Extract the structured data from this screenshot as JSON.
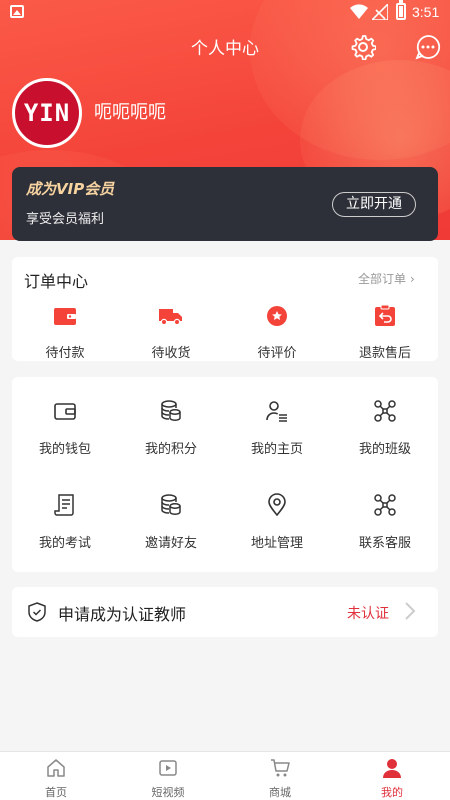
{
  "status_bar": {
    "time": "3:51"
  },
  "header": {
    "title": "个人中心"
  },
  "profile": {
    "avatar_text": "YIN",
    "username": "呃呃呃呃"
  },
  "vip": {
    "title": "成为VIP会员",
    "subtitle": "享受会员福利",
    "button": "立即开通"
  },
  "orders": {
    "title": "订单中心",
    "all_label": "全部订单",
    "items": [
      {
        "label": "待付款",
        "icon": "wallet-icon"
      },
      {
        "label": "待收货",
        "icon": "truck-icon"
      },
      {
        "label": "待评价",
        "icon": "star-badge-icon"
      },
      {
        "label": "退款售后",
        "icon": "refund-icon"
      }
    ]
  },
  "services": [
    {
      "label": "我的钱包",
      "icon": "wallet-outline-icon"
    },
    {
      "label": "我的积分",
      "icon": "coins-icon"
    },
    {
      "label": "我的主页",
      "icon": "user-list-icon"
    },
    {
      "label": "我的班级",
      "icon": "nodes-icon"
    },
    {
      "label": "我的考试",
      "icon": "scroll-icon"
    },
    {
      "label": "邀请好友",
      "icon": "coins-icon"
    },
    {
      "label": "地址管理",
      "icon": "location-pin-icon"
    },
    {
      "label": "联系客服",
      "icon": "nodes-icon"
    }
  ],
  "teacher": {
    "label": "申请成为认证教师",
    "status": "未认证"
  },
  "tabbar": [
    {
      "label": "首页",
      "icon": "home-icon"
    },
    {
      "label": "短视频",
      "icon": "video-icon"
    },
    {
      "label": "商城",
      "icon": "cart-icon"
    },
    {
      "label": "我的",
      "icon": "person-icon",
      "active": true
    }
  ],
  "colors": {
    "primary": "#f4443a",
    "vip_bg": "#2d3039",
    "vip_gold": "#f7d3a0",
    "accent_red": "#e0303a"
  }
}
